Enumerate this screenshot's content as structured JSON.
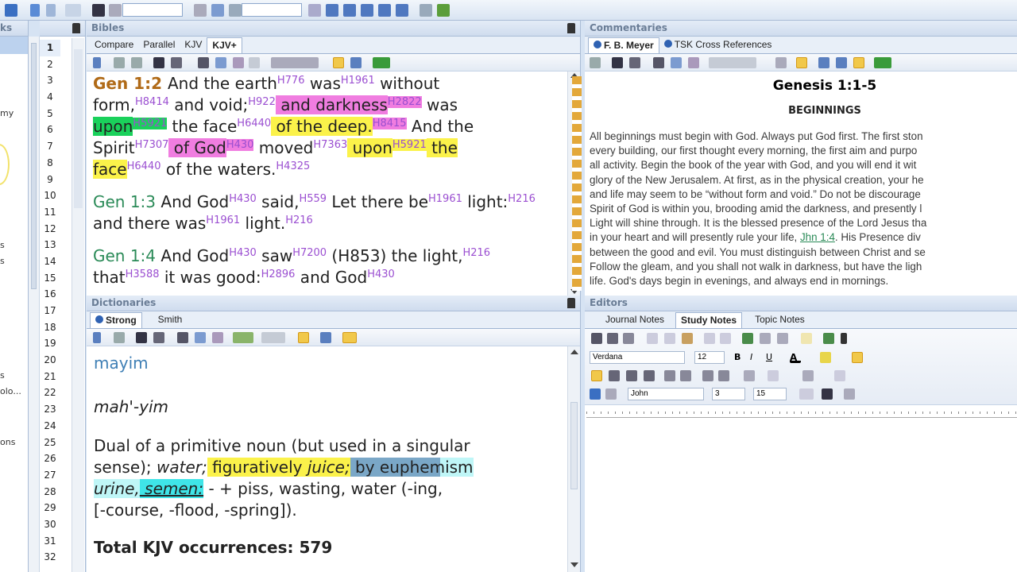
{
  "left_panel": {
    "title": "ks",
    "fragments": [
      "my",
      "s",
      "s",
      "s",
      "olo...",
      "ons"
    ]
  },
  "line_numbers": [
    "1",
    "2",
    "3",
    "4",
    "5",
    "6",
    "7",
    "8",
    "9",
    "10",
    "11",
    "12",
    "13",
    "14",
    "15",
    "16",
    "17",
    "18",
    "19",
    "20",
    "21",
    "22",
    "23",
    "24",
    "25",
    "26",
    "27",
    "28",
    "29",
    "30",
    "31",
    "32"
  ],
  "bibles": {
    "title": "Bibles",
    "tabs": [
      "Compare",
      "Parallel",
      "KJV",
      "KJV+"
    ],
    "active_tab": "KJV+",
    "verses": [
      {
        "ref": "Gen 1:2",
        "lines": [
          "And the earth|H776| was|H1961| without",
          "form,|H8414| and void;|H922| and darkness|H2822| was",
          "upon|H5921| the face|H6440| of the deep.|H8415| And the",
          "Spirit|H7307| of God|H430| moved|H7363| upon|H5921| the",
          "face|H6440| of the waters.|H4325|"
        ]
      },
      {
        "ref": "Gen 1:3",
        "text": "And God|H430| said,|H559| Let there be|H1961| light:|H216| and there was|H1961| light.|H216|"
      },
      {
        "ref": "Gen 1:4",
        "text": "And God|H430| saw|H7200| (H853) the light,|H216| that|H3588| it was good:|H2896| and God|H430|"
      }
    ]
  },
  "commentaries": {
    "title": "Commentaries",
    "tabs": [
      "F. B. Meyer",
      "TSK Cross References"
    ],
    "active_tab": "F. B. Meyer",
    "heading": "Genesis 1:1-5",
    "subheading": "BEGINNINGS",
    "lines": [
      "All beginnings must begin with God. Always put God first. The first ston",
      "every building, our first thought every morning, the first aim and purpo",
      "all activity. Begin the book of the year with God, and you will end it wit",
      "glory of the New Jerusalem. At first, as in the physical creation, your he",
      "and life may seem to be “without form and void.” Do not be discourage",
      "Spirit of God is within you, brooding amid the darkness, and presently l",
      "Light will shine through. It is the blessed presence of the Lord Jesus tha",
      "in your heart and will presently rule your life, ",
      "between the good and evil. You must distinguish between Christ and se",
      "Follow the gleam, and you shall not walk in darkness, but have the ligh",
      "life. God's days begin in evenings, and always end in mornings."
    ],
    "link": "Jhn 1:4",
    "link_after": ". His Presence div"
  },
  "dictionaries": {
    "title": "Dictionaries",
    "tabs": [
      "Strong",
      "Smith"
    ],
    "active_tab": "Strong",
    "word": "mayim",
    "pron": "mah'-yim",
    "def1": "Dual of a primitive noun (but used in a singular",
    "def2a": "sense); ",
    "def2b": "water;",
    "def2c": " figuratively ",
    "def2d": "juice;",
    "def2e": " by euphemism",
    "def3a": "urine,",
    "def3b": " semen:",
    "def3c": " -  + piss, wasting, water (-ing,",
    "def4": "[-course, -flood, -spring]).",
    "total": "Total KJV occurrences: 579"
  },
  "editors": {
    "title": "Editors",
    "tabs": [
      "Journal Notes",
      "Study Notes",
      "Topic Notes"
    ],
    "active_tab": "Study Notes",
    "font_name": "Verdana",
    "font_size": "12",
    "author": "John",
    "field2": "3",
    "field3": "15"
  }
}
